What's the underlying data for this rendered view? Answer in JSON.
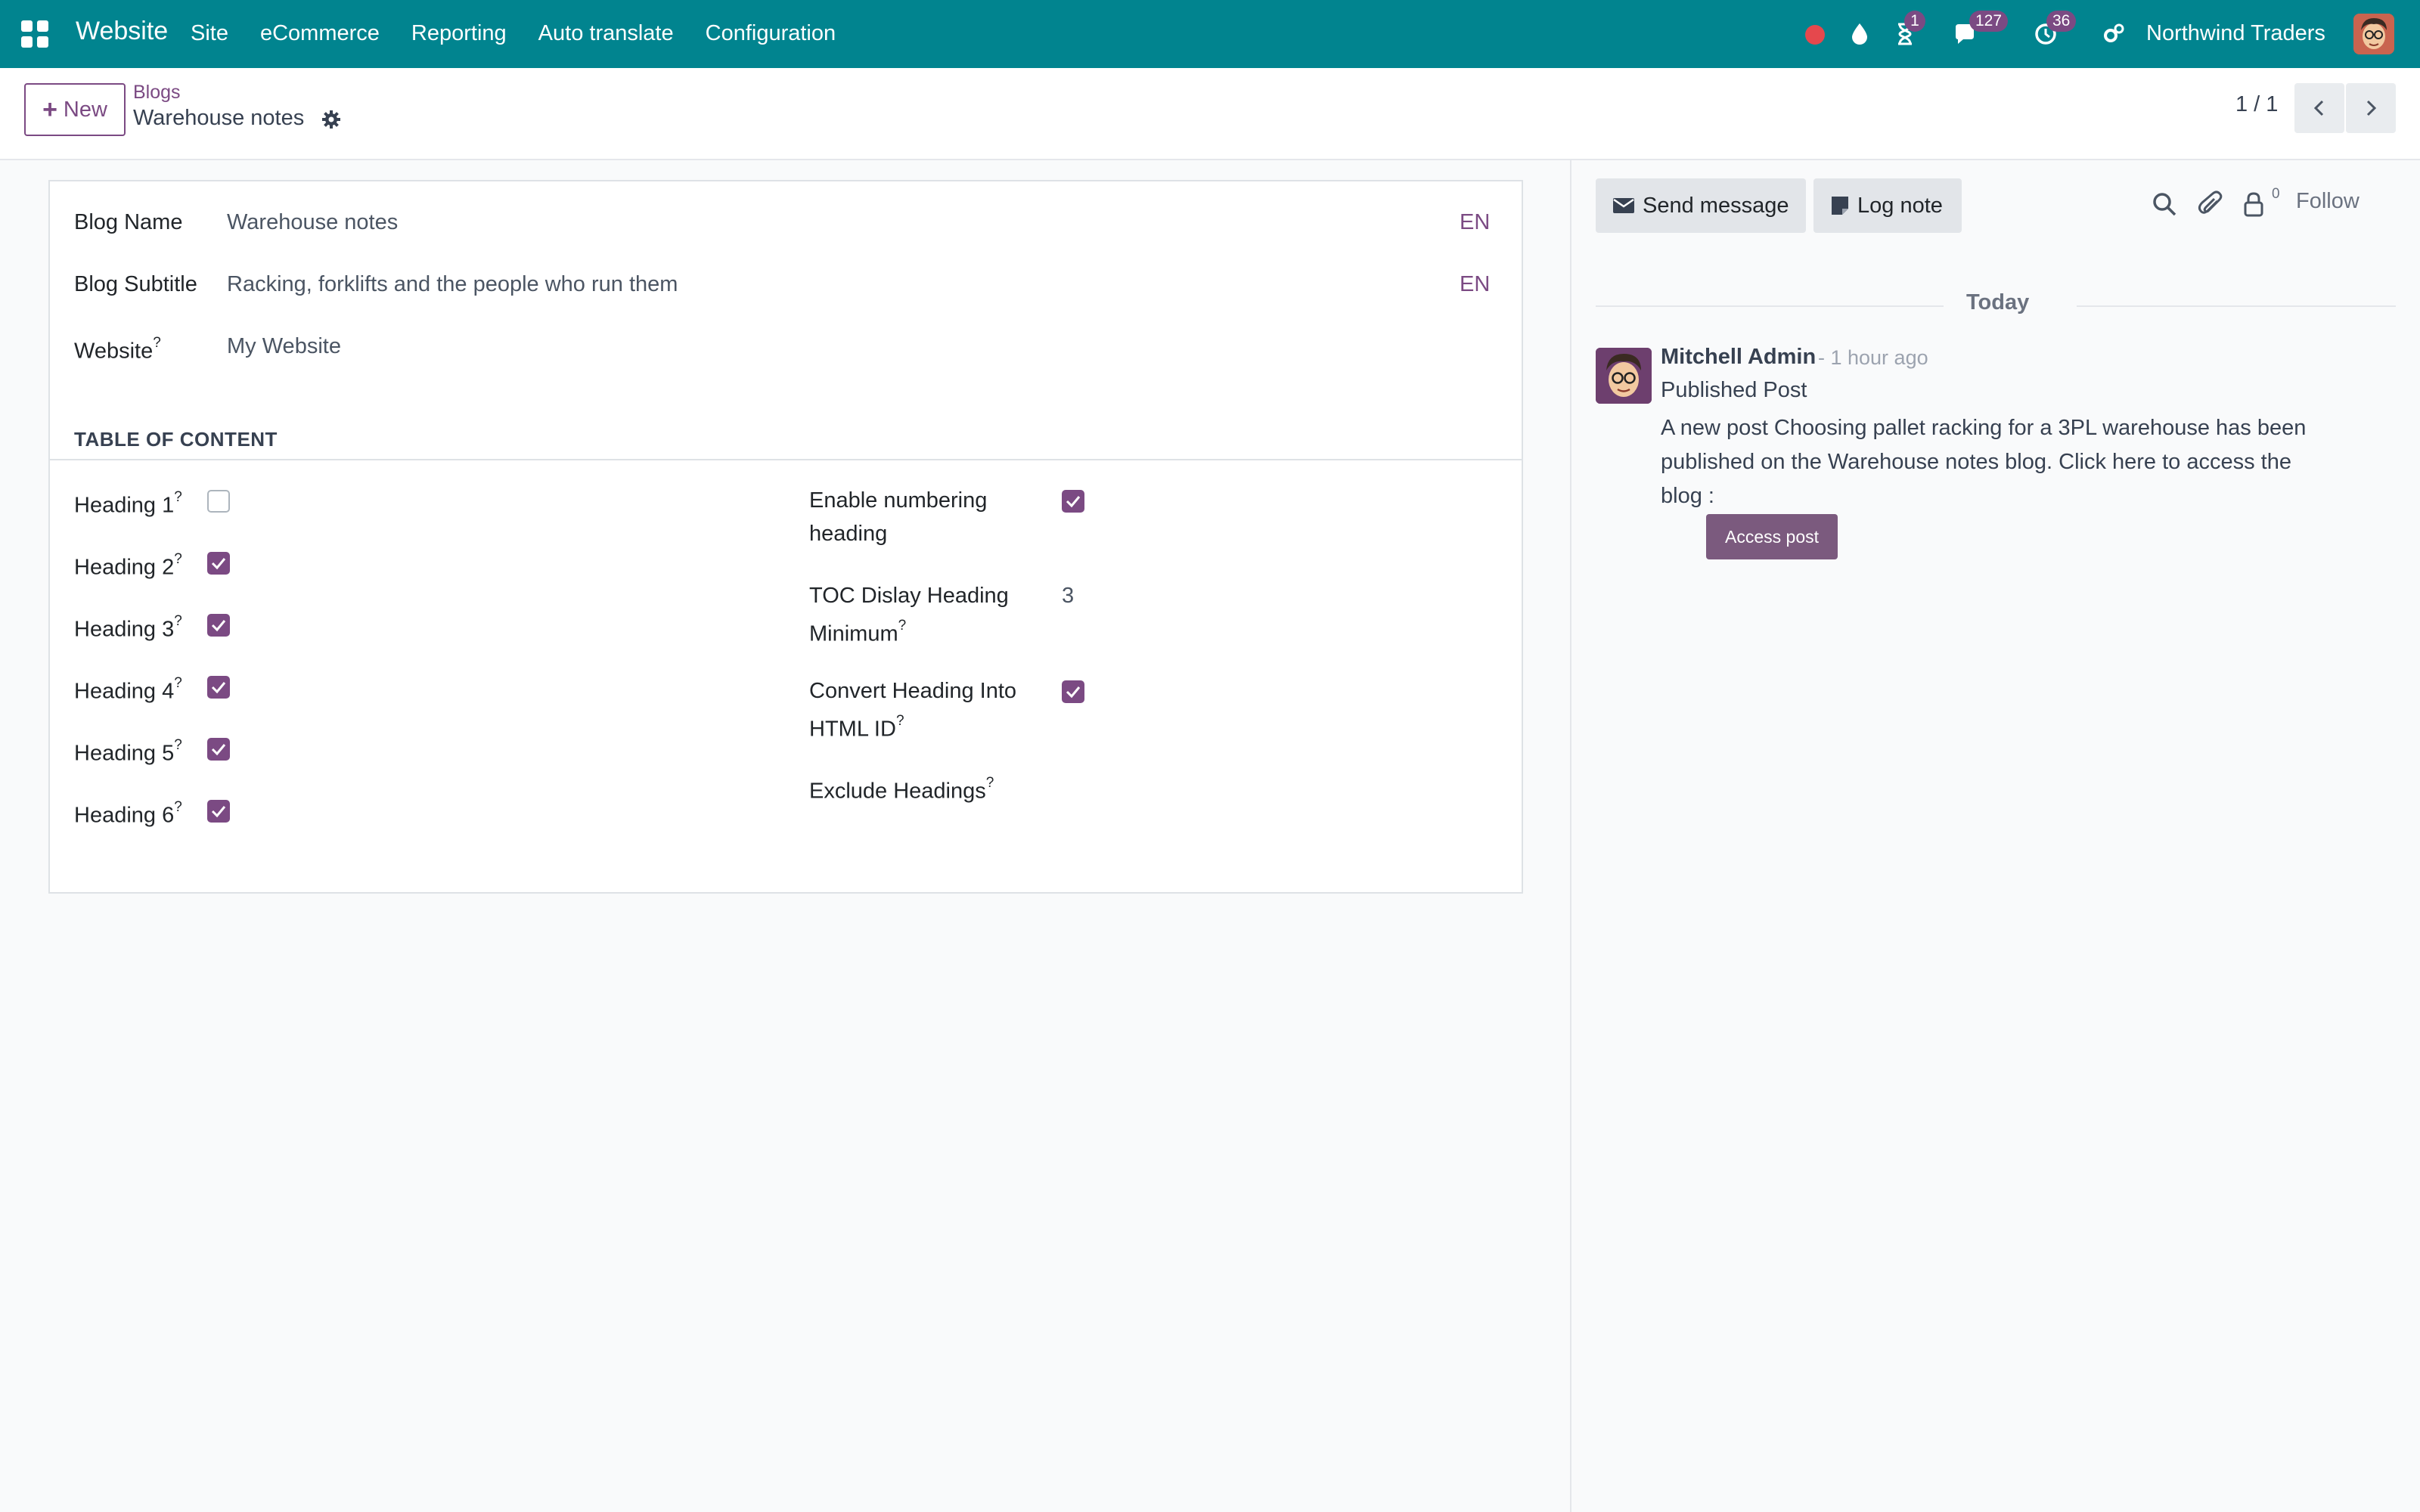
{
  "navbar": {
    "app_name": "Website",
    "menu": [
      "Site",
      "eCommerce",
      "Reporting",
      "Auto translate",
      "Configuration"
    ],
    "badges": {
      "activity_timer": "1",
      "messages": "127",
      "activities": "36"
    },
    "company": "Northwind Traders",
    "icons": [
      "apps-icon",
      "recording-dot-icon",
      "drop-icon",
      "hourglass-icon",
      "chat-icon",
      "clock-icon",
      "settings-icon",
      "user-avatar"
    ],
    "color": "#01848f"
  },
  "control": {
    "new_label": "New",
    "breadcrumb_parent": "Blogs",
    "breadcrumb_current": "Warehouse notes",
    "pager": "1 / 1"
  },
  "form": {
    "fields": {
      "blog_name": {
        "label": "Blog Name",
        "value": "Warehouse notes",
        "lang": "EN"
      },
      "blog_subtitle": {
        "label": "Blog Subtitle",
        "value": "Racking, forklifts and the people who run them",
        "lang": "EN"
      },
      "website": {
        "label": "Website",
        "value": "My Website"
      }
    },
    "toc": {
      "title": "TABLE OF CONTENT",
      "headings": [
        {
          "label": "Heading 1",
          "checked": false
        },
        {
          "label": "Heading 2",
          "checked": true
        },
        {
          "label": "Heading 3",
          "checked": true
        },
        {
          "label": "Heading 4",
          "checked": true
        },
        {
          "label": "Heading 5",
          "checked": true
        },
        {
          "label": "Heading 6",
          "checked": true
        }
      ],
      "enable_numbering": {
        "label_line1": "Enable numbering",
        "label_line2": "heading",
        "checked": true
      },
      "toc_min": {
        "label_line1": "TOC Dislay Heading",
        "label_line2": "Minimum",
        "value": "3"
      },
      "convert_html_id": {
        "label_line1": "Convert Heading Into",
        "label_line2": "HTML ID",
        "checked": true
      },
      "exclude_headings": {
        "label": "Exclude Headings"
      }
    },
    "help_mark": "?"
  },
  "chatter": {
    "send_message": "Send message",
    "log_note": "Log note",
    "follower_count": "0",
    "follow": "Follow",
    "date_separator": "Today",
    "message": {
      "author": "Mitchell Admin",
      "time": "- 1 hour ago",
      "subject": "Published Post",
      "body": "A new post Choosing pallet racking for a 3PL warehouse has been published on the Warehouse notes blog. Click here to access the blog :",
      "button": "Access post"
    }
  },
  "colors": {
    "primary": "#7b4a83",
    "navbar": "#01848f"
  }
}
